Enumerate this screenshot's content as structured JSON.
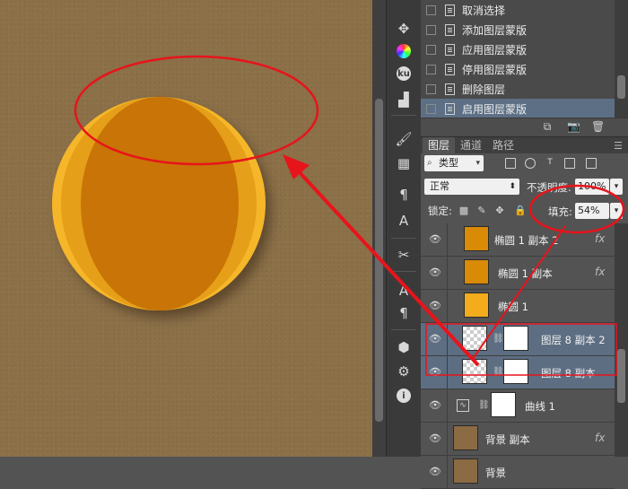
{
  "history": {
    "items": [
      {
        "label": "取消选择",
        "selected": false
      },
      {
        "label": "添加图层蒙版",
        "selected": false
      },
      {
        "label": "应用图层蒙版",
        "selected": false
      },
      {
        "label": "停用图层蒙版",
        "selected": false
      },
      {
        "label": "删除图层",
        "selected": false
      },
      {
        "label": "启用图层蒙版",
        "selected": true
      }
    ]
  },
  "layers_panel": {
    "tabs": [
      "图层",
      "通道",
      "路径"
    ],
    "active_tab": "图层",
    "filter": {
      "label": "类型"
    },
    "blend_mode": "正常",
    "opacity_label": "不透明度:",
    "opacity_value": "100%",
    "lock_label": "锁定:",
    "fill_label": "填充:",
    "fill_value": "54%",
    "layers": [
      {
        "name": "椭圆 1 副本 2",
        "thumb": "orange",
        "fx": "fx",
        "selected": false
      },
      {
        "name": "椭圆 1 副本",
        "thumb": "orange",
        "fx": "fx",
        "selected": false
      },
      {
        "name": "椭圆 1",
        "thumb": "orange",
        "fx": "",
        "selected": false
      },
      {
        "name": "图层 8 副本 2",
        "thumb": "mask",
        "fx": "",
        "selected": true
      },
      {
        "name": "图层 8 副本",
        "thumb": "mask",
        "fx": "",
        "selected": true
      },
      {
        "name": "曲线 1",
        "thumb": "curves",
        "fx": "",
        "selected": false
      },
      {
        "name": "背景 副本",
        "thumb": "brown",
        "fx": "fx",
        "selected": false
      },
      {
        "name": "背景",
        "thumb": "brown",
        "fx": "",
        "selected": false
      }
    ]
  },
  "colors": {
    "canvas_bg": "#8b7048",
    "coin_outer": "#f6b62a",
    "coin_inner": "#c87406",
    "annotation": "#e8141b",
    "selection": "#5d6e83"
  },
  "icons": [
    "pan-icon",
    "color-wheel-icon",
    "kuler-icon",
    "histogram-icon",
    "brush-icon",
    "swatch-icon",
    "paragraph-style-icon",
    "character-style-icon",
    "tools-icon",
    "text-icon",
    "paragraph-icon",
    "3d-icon",
    "properties-icon",
    "info-icon"
  ]
}
